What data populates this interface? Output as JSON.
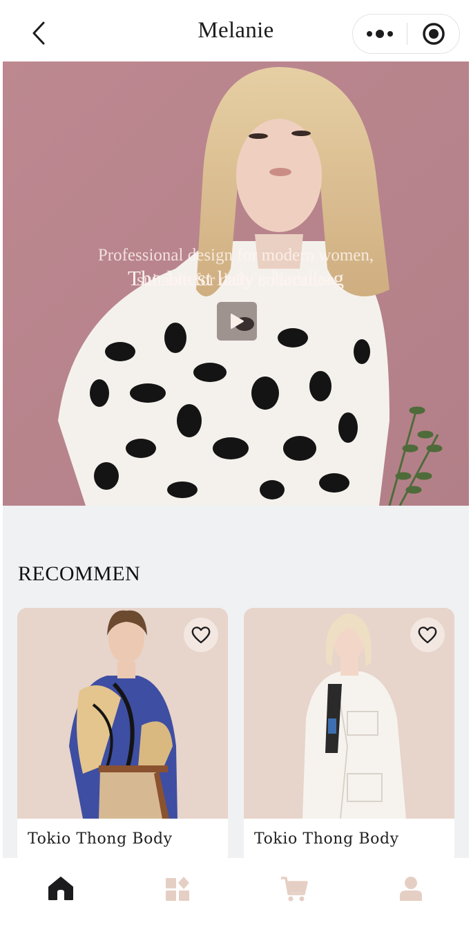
{
  "header": {
    "title": "Melanie",
    "back_icon": "chevron-left-icon",
    "more_icon": "more-dots-icon",
    "target_icon": "target-icon"
  },
  "hero": {
    "title": "The latest lady's handbag",
    "subtitle_line1": "Professional design for modern women,",
    "subtitle_line2": "suitable for daily collocation",
    "play_icon": "play-icon"
  },
  "recommend": {
    "title": "RECOMMEN",
    "products": [
      {
        "name": "Tokio Thong Body",
        "favorite_icon": "heart-outline-icon"
      },
      {
        "name": "Tokio Thong Body",
        "favorite_icon": "heart-outline-icon"
      }
    ]
  },
  "tabbar": {
    "tabs": [
      {
        "icon": "home-icon",
        "active": true
      },
      {
        "icon": "category-icon",
        "active": false
      },
      {
        "icon": "cart-icon",
        "active": false
      },
      {
        "icon": "profile-icon",
        "active": false
      }
    ],
    "active_color": "#1c1c1e",
    "inactive_color": "#e5cfc4"
  },
  "colors": {
    "hero_background": "#bb8791",
    "card_background": "#e7d4ca",
    "page_background": "#f0f1f3"
  }
}
